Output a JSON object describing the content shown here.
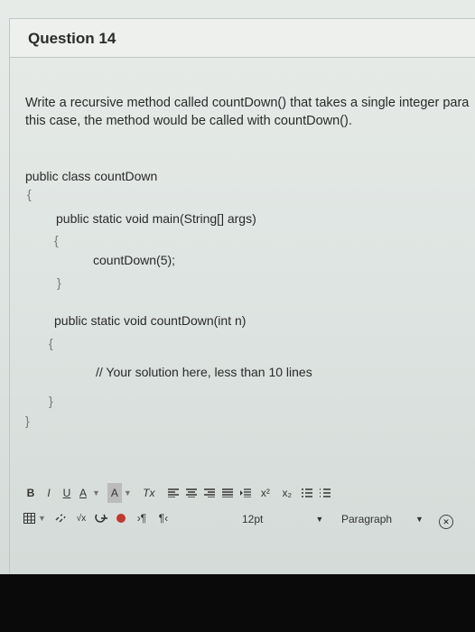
{
  "question": {
    "title": "Question 14"
  },
  "prompt": {
    "line1": "Write a recursive method called countDown() that takes a single integer para",
    "line2": "this case, the method would be called with countDown()."
  },
  "code": {
    "class_decl": "public class countDown",
    "open_brace1": "{",
    "main_decl": "public static void main(String[] args)",
    "open_brace2": "{",
    "call": "countDown(5);",
    "close_brace2": "}",
    "method_decl": "public static void countDown(int n)",
    "open_brace3": "{",
    "comment": "// Your solution here, less than 10 lines",
    "close_brace3": "}",
    "close_brace1": "}"
  },
  "toolbar": {
    "bold": "B",
    "italic": "I",
    "underline": "U",
    "font_color": "A",
    "highlight": "A",
    "clear_format": "Tx",
    "superscript": "x²",
    "subscript": "x₂",
    "font_size": "12pt",
    "paragraph": "Paragraph"
  }
}
